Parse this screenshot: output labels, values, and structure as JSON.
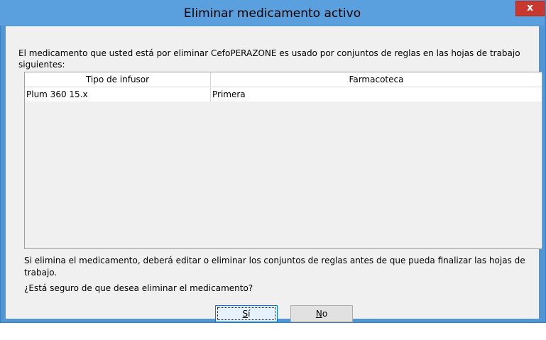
{
  "window": {
    "title": "Eliminar medicamento activo",
    "close_glyph": "x"
  },
  "message": {
    "line1": "El medicamento que usted está por eliminar CefoPERAZONE es usado por conjuntos de reglas en las hojas de trabajo",
    "line2": "siguientes:"
  },
  "table": {
    "columns": [
      "Tipo de infusor",
      "Farmacoteca"
    ],
    "rows": [
      [
        "Plum 360 15.x",
        "Primera"
      ]
    ]
  },
  "warning": {
    "line1": "Si elimina el medicamento, deberá editar o eliminar los conjuntos de reglas antes de que pueda finalizar las hojas de",
    "line2": "trabajo."
  },
  "question": "¿Está seguro de que desea eliminar el medicamento?",
  "buttons": {
    "yes_mnemonic": "S",
    "yes_rest": "í",
    "no_mnemonic": "N",
    "no_rest": "o"
  },
  "colors": {
    "titlebar": "#5aa0de",
    "close_button": "#c7382f",
    "dialog_background": "#f0f0f0",
    "default_button_border": "#0078d7"
  }
}
